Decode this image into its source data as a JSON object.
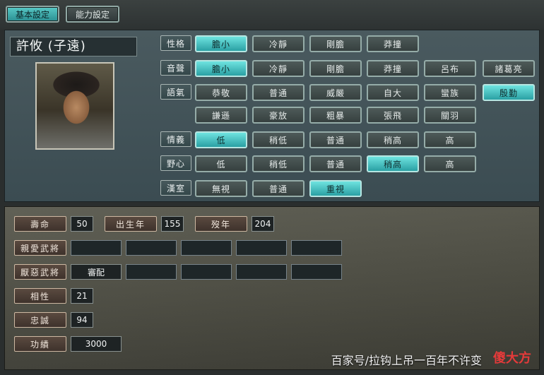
{
  "tabs": [
    {
      "label": "基本設定",
      "active": true
    },
    {
      "label": "能力設定",
      "active": false
    }
  ],
  "character": {
    "name": "許攸 (子遠)"
  },
  "rows": {
    "personality": {
      "label": "性格",
      "options": [
        "膽小",
        "冷靜",
        "剛膽",
        "莽撞"
      ],
      "selected": "膽小"
    },
    "voice": {
      "label": "音聲",
      "options": [
        "膽小",
        "冷靜",
        "剛膽",
        "莽撞",
        "呂布",
        "諸葛亮"
      ],
      "selected": "膽小"
    },
    "tone": {
      "label": "語氣",
      "options": [
        "恭敬",
        "普通",
        "威嚴",
        "自大",
        "蠻族",
        "殷勤",
        "謙遜",
        "豪放",
        "粗暴",
        "張飛",
        "關羽"
      ],
      "selected": "殷勤"
    },
    "loyalty_feel": {
      "label": "情義",
      "options": [
        "低",
        "稍低",
        "普通",
        "稍高",
        "高"
      ],
      "selected": "低"
    },
    "ambition": {
      "label": "野心",
      "options": [
        "低",
        "稍低",
        "普通",
        "稍高",
        "高"
      ],
      "selected": "稍高"
    },
    "han": {
      "label": "漢室",
      "options": [
        "無視",
        "普通",
        "重視"
      ],
      "selected": "重視"
    }
  },
  "stats": {
    "lifespan": {
      "label": "壽命",
      "value": "50"
    },
    "birth_year": {
      "label": "出生年",
      "value": "155"
    },
    "death_year": {
      "label": "歿年",
      "value": "204"
    },
    "liked": {
      "label": "親愛武將",
      "values": [
        "",
        "",
        "",
        "",
        ""
      ]
    },
    "disliked": {
      "label": "厭惡武將",
      "values": [
        "審配",
        "",
        "",
        "",
        ""
      ]
    },
    "compat": {
      "label": "相性",
      "value": "21"
    },
    "loyalty": {
      "label": "忠誠",
      "value": "94"
    },
    "merit": {
      "label": "功績",
      "value": "3000"
    }
  },
  "watermark": {
    "text": "百家号/拉钩上吊一百年不许变",
    "logo": "傻大方"
  },
  "colors": {
    "selected": "#2aa0a3",
    "unselected": "#3e4847",
    "upper_panel": "#3f5055",
    "lower_panel": "#4d4c42"
  }
}
